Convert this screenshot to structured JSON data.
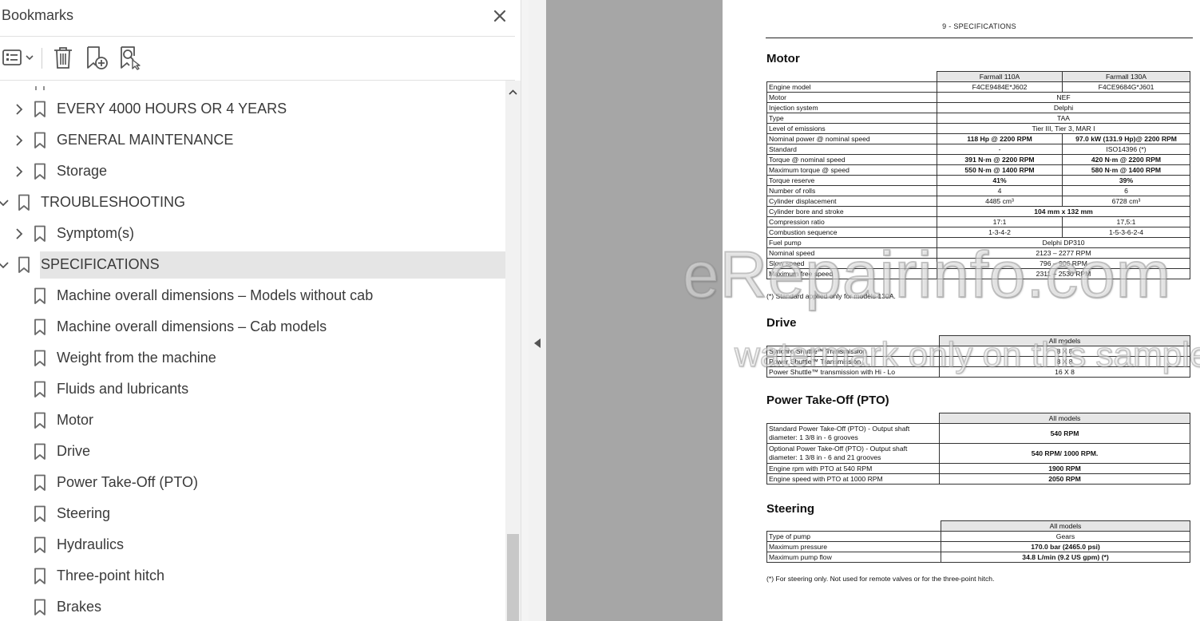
{
  "panel": {
    "title": "Bookmarks",
    "bookmarks": [
      {
        "label": "EVERY 4000 HOURS OR 4 YEARS",
        "level": 1,
        "toggle": "collapsed"
      },
      {
        "label": "GENERAL MAINTENANCE",
        "level": 1,
        "toggle": "collapsed"
      },
      {
        "label": "Storage",
        "level": 1,
        "toggle": "collapsed"
      },
      {
        "label": "TROUBLESHOOTING",
        "level": 0,
        "toggle": "expanded"
      },
      {
        "label": "Symptom(s)",
        "level": 1,
        "toggle": "collapsed"
      },
      {
        "label": "SPECIFICATIONS",
        "level": 0,
        "toggle": "expanded",
        "selected": true
      },
      {
        "label": "Machine overall dimensions  – Models without cab",
        "level": 1,
        "toggle": "none"
      },
      {
        "label": "Machine overall dimensions  – Cab models",
        "level": 1,
        "toggle": "none"
      },
      {
        "label": "Weight from the machine",
        "level": 1,
        "toggle": "none"
      },
      {
        "label": "Fluids and lubricants",
        "level": 1,
        "toggle": "none"
      },
      {
        "label": "Motor",
        "level": 1,
        "toggle": "none"
      },
      {
        "label": "Drive",
        "level": 1,
        "toggle": "none"
      },
      {
        "label": "Power Take-Off (PTO)",
        "level": 1,
        "toggle": "none"
      },
      {
        "label": "Steering",
        "level": 1,
        "toggle": "none"
      },
      {
        "label": "Hydraulics",
        "level": 1,
        "toggle": "none"
      },
      {
        "label": "Three-point hitch",
        "level": 1,
        "toggle": "none"
      },
      {
        "label": "Brakes",
        "level": 1,
        "toggle": "none"
      }
    ]
  },
  "doc": {
    "header": "9 - SPECIFICATIONS",
    "motor": {
      "title": "Motor",
      "col1": "Farmall 110A",
      "col2": "Farmall 130A",
      "rows": [
        {
          "label": "Engine model",
          "v1": "F4CE9484E*J602",
          "v2": "F4CE9684G*J601"
        },
        {
          "label": "Motor",
          "span": "NEF"
        },
        {
          "label": "Injection system",
          "span": "Delphi"
        },
        {
          "label": "Type",
          "span": "TAA"
        },
        {
          "label": "Level of emissions",
          "span": "Tier III, Tier 3, MAR I"
        },
        {
          "label": "Nominal power @ nominal speed",
          "v1": "118 Hp @ 2200 RPM",
          "v2": "97.0 kW (131.9 Hp)@ 2200 RPM",
          "bold": true
        },
        {
          "label": "Standard",
          "v1": "-",
          "v2": "ISO14396 (*)"
        },
        {
          "label": "Torque @ nominal speed",
          "v1": "391 N·m @ 2200 RPM",
          "v2": "420 N·m @ 2200 RPM",
          "bold": true
        },
        {
          "label": "Maximum torque @ speed",
          "v1": "550 N·m @ 1400 RPM",
          "v2": "580 N·m @ 1400 RPM",
          "bold": true
        },
        {
          "label": "Torque reserve",
          "v1": "41%",
          "v2": "39%",
          "bold": true
        },
        {
          "label": "Number of rolls",
          "v1": "4",
          "v2": "6"
        },
        {
          "label": "Cylinder displacement",
          "v1": "4485 cm³",
          "v2": "6728 cm³"
        },
        {
          "label": "Cylinder bore and stroke",
          "span": "104 mm x 132 mm",
          "bold": true
        },
        {
          "label": "Compression ratio",
          "v1": "17:1",
          "v2": "17,5:1"
        },
        {
          "label": "Combustion sequence",
          "v1": "1-3-4-2",
          "v2": "1-5-3-6-2-4"
        },
        {
          "label": "Fuel pump",
          "span": "Delphi DP310"
        },
        {
          "label": "Nominal speed",
          "span": "2123 – 2277 RPM"
        },
        {
          "label": "Slow speed",
          "span": "796 – 906 RPM"
        },
        {
          "label": "Maximum free speed",
          "span": "2311 – 2530 RPM"
        }
      ],
      "note": "(*) Standard applied only for models 130A."
    },
    "drive": {
      "title": "Drive",
      "col": "All models",
      "rows": [
        {
          "label": "Synchro Shuttle™ Transmission",
          "value": "8 X 8"
        },
        {
          "label": "Power Shuttle™ Transmission",
          "value": "8 X 8"
        },
        {
          "label": "Power Shuttle™ transmission with Hi - Lo",
          "value": "16 X 8"
        }
      ]
    },
    "pto": {
      "title": "Power Take-Off (PTO)",
      "col": "All models",
      "rows": [
        {
          "label": "Standard Power Take-Off (PTO) - Output shaft diameter:  1 3/8 in - 6 grooves",
          "value": "540 RPM",
          "tall": true
        },
        {
          "label": "Optional Power Take-Off (PTO) - Output shaft diameter:  1 3/8 in - 6 and 21 grooves",
          "value": "540 RPM/ 1000 RPM.",
          "tall": true
        },
        {
          "label": "Engine rpm with PTO at 540 RPM",
          "value": "1900 RPM"
        },
        {
          "label": "Engine speed with PTO at 1000 RPM",
          "value": "2050 RPM"
        }
      ]
    },
    "steering": {
      "title": "Steering",
      "col": "All models",
      "rows": [
        {
          "label": "Type of pump",
          "value": "Gears",
          "bold": false
        },
        {
          "label": "Maximum pressure",
          "value": "170.0 bar (2465.0 psi)",
          "bold": true
        },
        {
          "label": "Maximum pump flow",
          "value": "34.8 L/min (9.2 US gpm) (*)",
          "bold": true
        }
      ],
      "note": "(*) For steering only.  Not used for remote valves or for the three-point hitch."
    },
    "watermark": {
      "line1": "eRepairinfo.com",
      "line2": "watermark only on this sample"
    }
  }
}
